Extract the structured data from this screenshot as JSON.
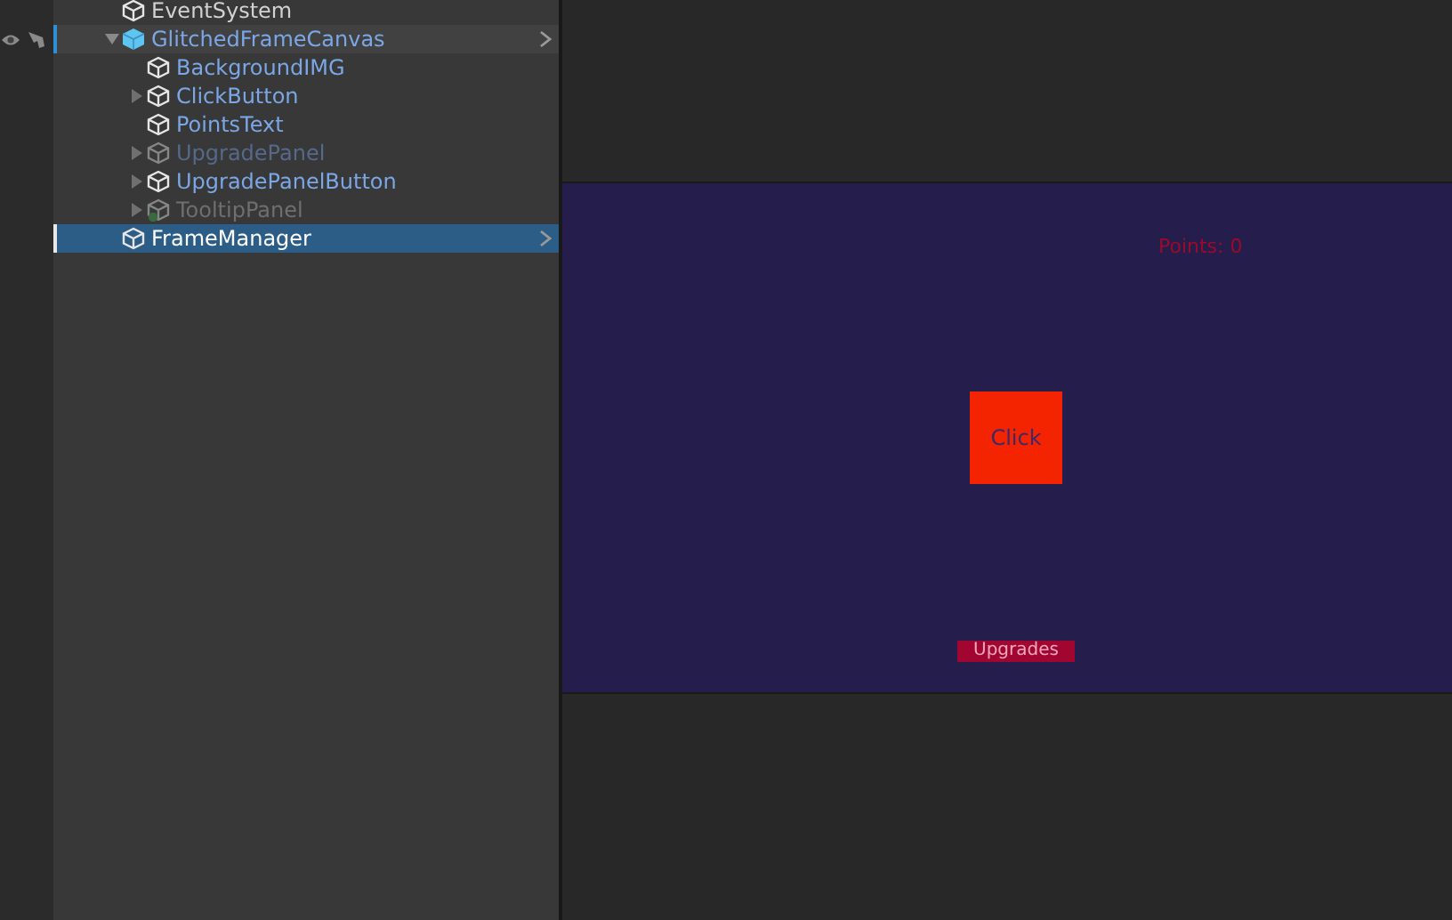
{
  "hierarchy": {
    "items": [
      {
        "name": "EventSystem",
        "kind": "object",
        "active": true,
        "selected": false,
        "highlighted": false
      },
      {
        "name": "GlitchedFrameCanvas",
        "kind": "prefab",
        "active": true,
        "selected": false,
        "highlighted": true,
        "expanded": true,
        "children": [
          {
            "name": "BackgroundIMG",
            "kind": "prefab_child",
            "active": true,
            "selected": false,
            "highlighted": false
          },
          {
            "name": "ClickButton",
            "kind": "prefab_child",
            "active": true,
            "selected": false,
            "highlighted": false,
            "expanded": false
          },
          {
            "name": "PointsText",
            "kind": "prefab_child",
            "active": true,
            "selected": false,
            "highlighted": false
          },
          {
            "name": "UpgradePanel",
            "kind": "prefab_child",
            "active": false,
            "selected": false,
            "highlighted": false,
            "expanded": false
          },
          {
            "name": "UpgradePanelButton",
            "kind": "prefab_child",
            "active": true,
            "selected": false,
            "highlighted": false,
            "expanded": false
          },
          {
            "name": "TooltipPanel",
            "kind": "object",
            "active": false,
            "selected": false,
            "highlighted": false,
            "expanded": false,
            "added": true
          }
        ]
      },
      {
        "name": "FrameManager",
        "kind": "object",
        "active": true,
        "selected": true,
        "highlighted": false
      }
    ]
  },
  "game_view": {
    "points_text": "Points: 0",
    "click_button": "Click",
    "upgrades_button": "Upgrades"
  }
}
